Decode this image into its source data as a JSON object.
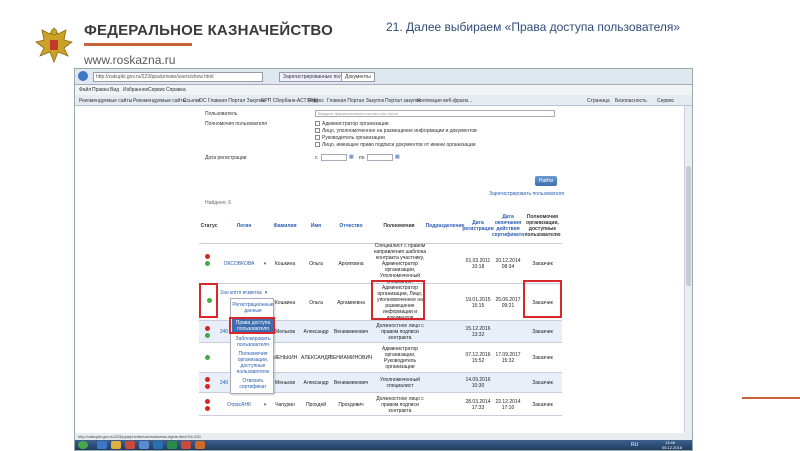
{
  "slide": {
    "org_title": "ФЕДЕРАЛЬНОЕ КАЗНАЧЕЙСТВО",
    "site": "www.roskazna.ru",
    "title": "21. Далее выбираем «Права доступа пользователя»"
  },
  "browser": {
    "url": "http://zakupki.gov.ru/223/ppa/private/users/show.html",
    "tabs": [
      "Зарегистрированные пользо...",
      "Документы"
    ],
    "menu": [
      "Файл",
      "Правка",
      "Вид",
      "Избранное",
      "Сервис",
      "Справка"
    ],
    "favorites": [
      "Рекомендуемые сайты",
      "Рекомендуемые сайты",
      "Ссылки",
      "ОС Главная Портал Закупок",
      "ЕРП Сбербанк-АСТ (РФ)",
      "Яндекс",
      "Главная Портал Закупок",
      "Портал закупок",
      "Коллекция веб-фрагм..."
    ],
    "tools": [
      "Страница",
      "Безопасность",
      "Сервис"
    ]
  },
  "form": {
    "user_label": "Пользователь",
    "user_placeholder": "Введите фамилию/имя/отчество или логин",
    "role_label": "Полномочия пользователя",
    "roles": [
      "Администратор организации",
      "Лицо, уполномоченное на размещение информации и документов",
      "Руководитель организации",
      "Лицо, имеющее право подписи документов от имени организации"
    ],
    "reg_date_label": "Дата регистрации",
    "from": "с",
    "to": "по",
    "find_button": "Найти",
    "register_link": "Зарегистрировать пользователя",
    "found": "Найдено: 6"
  },
  "table": {
    "headers": [
      "Статус",
      "Логин",
      "Фамилия",
      "Имя",
      "Отчество",
      "Полномочия",
      "Подразделение",
      "Дата регистрации",
      "Дата окончания действия сертификата",
      "Полномочия организации, доступные пользователю"
    ],
    "rows": [
      {
        "login": "ОКСОВКОВА",
        "surname": "Кошкина",
        "name": "Ольга",
        "patronymic": "Архиповна",
        "role": "Специалист с правом направления шаблона контракта участнику, Администратор организации, Уполномоченный специалист",
        "reg": "01.03.2011 10:18",
        "cert": "20.12.2014 08:34",
        "org_role": "Заказчик"
      },
      {
        "login": "2ао кпггп ягзвктка",
        "surname": "Кошкина",
        "name": "Ольга",
        "patronymic": "Аргамиевна",
        "role": "Администратор организации, Лицо, уполномоченное на размещение информации и документов",
        "reg": "19.01.2015 15:15",
        "cert": "25.06.2017 09:21",
        "org_role": "Заказчик"
      },
      {
        "login": "240",
        "surname": "Мельков",
        "name": "Александр",
        "patronymic": "Вениаминович",
        "role": "Должностное лицо с правом подписи контракта",
        "reg": "15.12.2016 13:32",
        "cert": "",
        "org_role": "Заказчик"
      },
      {
        "login": "",
        "surname": "МЕНЬКИН",
        "name": "АЛЕКСАНДР",
        "patronymic": "ВЕНИАМИНОВИЧ",
        "role": "Администратор организации, Руководитель организации",
        "reg": "07.12.2016 15:52",
        "cert": "17.09.2017 15:32",
        "org_role": "Заказчик"
      },
      {
        "login": "240",
        "surname": "Меньков",
        "name": "Александр",
        "patronymic": "Вениаминович",
        "role": "Уполномоченный специалист",
        "reg": "14.09.2016 10:30",
        "cert": "",
        "org_role": "Заказчик"
      },
      {
        "login": "ОтрасАНК",
        "surname": "Чапурин",
        "name": "Прохдей",
        "patronymic": "Прохдевич",
        "role": "Должностное лицо с правом подписи контракта",
        "reg": "28.03.2014 17:33",
        "cert": "22.12.2014 17:10",
        "org_role": "Заказчик"
      }
    ]
  },
  "dropdown": {
    "items": [
      "Регистрационные данные",
      "Права доступа пользователя",
      "Заблокировать пользователя",
      "Полномочия организации, доступные пользователю",
      "Отвязать сертификат"
    ]
  },
  "status_bar": "http://zakupki.gov.ru/223/ppa/private/users/access-rights.html?id=120",
  "taskbar": {
    "lang": "RU",
    "time": "13:48",
    "date": "05.12.2016"
  },
  "colors": {
    "accent_orange": "#c8643c",
    "highlight_red": "#d8282c",
    "link_blue": "#2a5db0",
    "title_blue": "#2f4b7a"
  }
}
